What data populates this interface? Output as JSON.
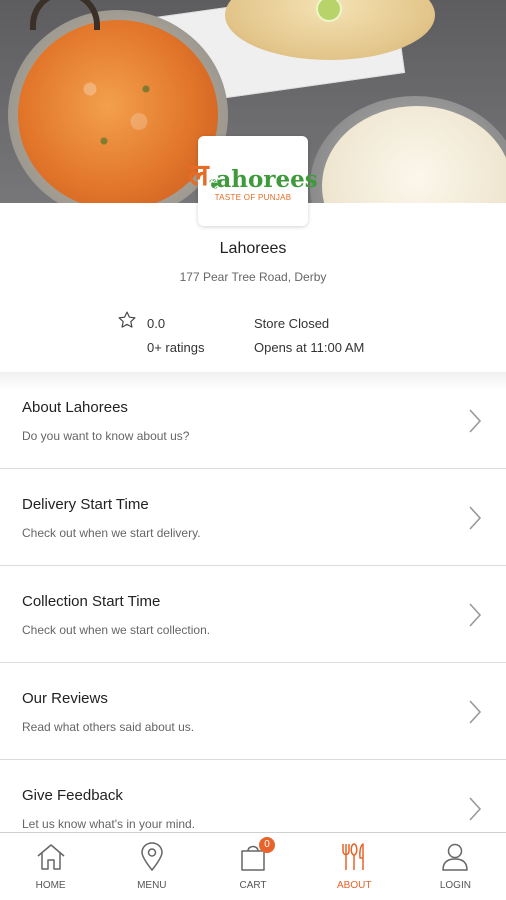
{
  "hero": {
    "logo_text": "ahorees",
    "logo_tagline": "TASTE OF PUNJAB"
  },
  "store": {
    "name": "Lahorees",
    "address": "177 Pear Tree Road, Derby",
    "rating": "0.0",
    "ratings_count": "0+ ratings",
    "status": "Store Closed",
    "opens_at": "Opens at 11:00 AM"
  },
  "menu": {
    "items": [
      {
        "title": "About Lahorees",
        "subtitle": "Do you want to know about us?"
      },
      {
        "title": "Delivery Start Time",
        "subtitle": "Check out when we start delivery."
      },
      {
        "title": "Collection Start Time",
        "subtitle": "Check out when we start collection."
      },
      {
        "title": "Our Reviews",
        "subtitle": "Read what others said about us."
      },
      {
        "title": "Give Feedback",
        "subtitle": "Let us know what's in your mind."
      }
    ]
  },
  "nav": {
    "items": [
      {
        "label": "HOME",
        "icon": "home-icon"
      },
      {
        "label": "MENU",
        "icon": "location-pin-icon"
      },
      {
        "label": "CART",
        "icon": "shopping-bag-icon",
        "badge": "0"
      },
      {
        "label": "ABOUT",
        "icon": "restaurant-icon",
        "active": true
      },
      {
        "label": "LOGIN",
        "icon": "user-icon"
      }
    ]
  },
  "colors": {
    "accent": "#e8632b",
    "brand_green": "#3f9a3c",
    "text_primary": "#222222",
    "text_secondary": "#666666",
    "divider": "#dcdcdc"
  }
}
